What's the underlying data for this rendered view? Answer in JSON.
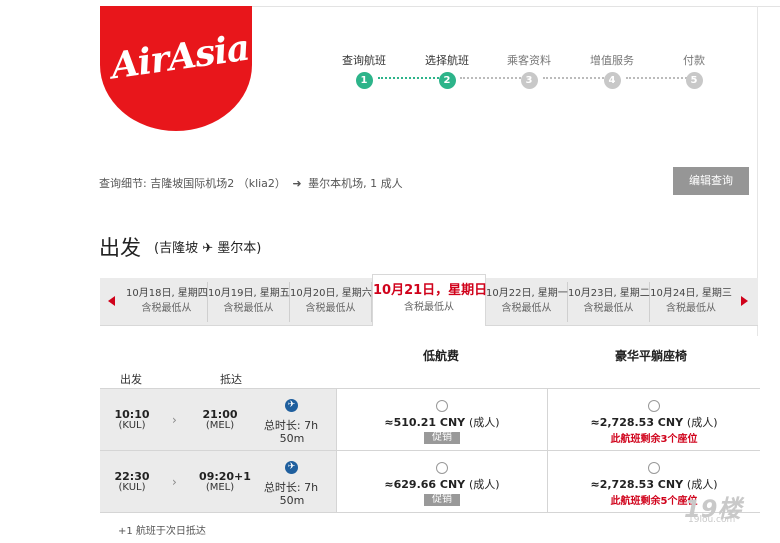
{
  "brand": {
    "logo_text": "AirAsia",
    "color": "#e8161b"
  },
  "steps": [
    {
      "label": "查询航班",
      "num": "1",
      "state": "done"
    },
    {
      "label": "选择航班",
      "num": "2",
      "state": "done"
    },
    {
      "label": "乘客资料",
      "num": "3",
      "state": "future"
    },
    {
      "label": "增值服务",
      "num": "4",
      "state": "future"
    },
    {
      "label": "付款",
      "num": "5",
      "state": "future"
    }
  ],
  "query": {
    "prefix": "查询细节: 吉隆坡国际机场2 （klia2）",
    "arrow": "➜",
    "suffix": "墨尔本机场, 1 成人",
    "edit_label": "编辑查询"
  },
  "departure": {
    "title": "出发",
    "route": "(吉隆坡  ✈  墨尔本)"
  },
  "dates": [
    {
      "date": "10月18日, 星期四",
      "price": "含税最低从"
    },
    {
      "date": "10月19日, 星期五",
      "price": "含税最低从"
    },
    {
      "date": "10月20日, 星期六",
      "price": "含税最低从"
    },
    {
      "date": "10月21日，星期日",
      "price": "含税最低从",
      "active": true
    },
    {
      "date": "10月22日, 星期一",
      "price": "含税最低从"
    },
    {
      "date": "10月23日, 星期二",
      "price": "含税最低从"
    },
    {
      "date": "10月24日, 星期三",
      "price": "含税最低从"
    }
  ],
  "columns": {
    "economy": "低航费",
    "premium": "豪华平躺座椅",
    "depart": "出发",
    "arrive": "抵达"
  },
  "flights": [
    {
      "dep_time": "10:10",
      "dep_code": "(KUL)",
      "arr_time": "21:00",
      "arr_code": "(MEL)",
      "duration_1": "总时长: 7h",
      "duration_2": "50m",
      "economy_price": "≈510.21 CNY",
      "economy_unit": "(成人)",
      "promo": "促销",
      "premium_price": "≈2,728.53 CNY",
      "premium_unit": "(成人)",
      "seats": "此航班剩余3个座位"
    },
    {
      "dep_time": "22:30",
      "dep_code": "(KUL)",
      "arr_time": "09:20+1",
      "arr_code": "(MEL)",
      "duration_1": "总时长: 7h",
      "duration_2": "50m",
      "economy_price": "≈629.66 CNY",
      "economy_unit": "(成人)",
      "promo": "促销",
      "premium_price": "≈2,728.53 CNY",
      "premium_unit": "(成人)",
      "seats": "此航班剩余5个座位"
    }
  ],
  "footnote": "+1 航班于次日抵达",
  "watermark": {
    "big": "19楼",
    "small": "19lou.com"
  },
  "icons": {
    "plane": "plane-icon",
    "chevron": "chevron-right-icon",
    "prev": "triangle-left-icon",
    "next": "triangle-right-icon"
  }
}
